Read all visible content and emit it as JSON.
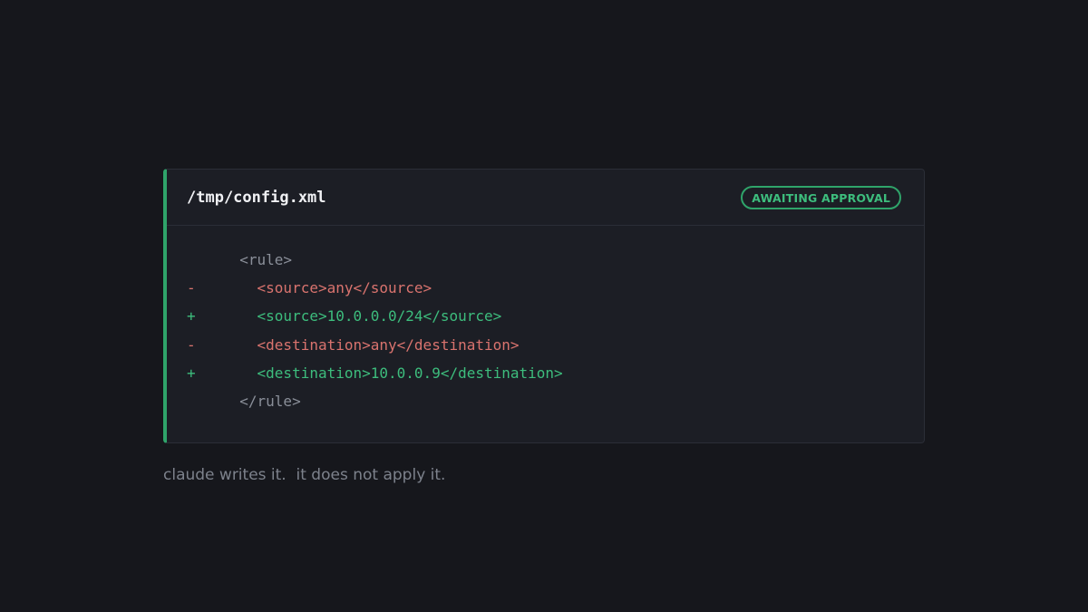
{
  "card": {
    "file_path": "/tmp/config.xml",
    "status": "AWAITING APPROVAL",
    "accent_color": "#2fa46a"
  },
  "diff": {
    "lines": [
      {
        "marker": "",
        "kind": "context",
        "text": "  <rule>"
      },
      {
        "marker": "-",
        "kind": "removed",
        "text": "    <source>any</source>"
      },
      {
        "marker": "+",
        "kind": "added",
        "text": "    <source>10.0.0.0/24</source>"
      },
      {
        "marker": "-",
        "kind": "removed",
        "text": "    <destination>any</destination>"
      },
      {
        "marker": "+",
        "kind": "added",
        "text": "    <destination>10.0.0.9</destination>"
      },
      {
        "marker": "",
        "kind": "context",
        "text": "  </rule>"
      }
    ],
    "colors": {
      "context": "#8a8f99",
      "removed": "#d9736e",
      "added": "#3dbd7d"
    }
  },
  "caption": "claude writes it.  it does not apply it."
}
